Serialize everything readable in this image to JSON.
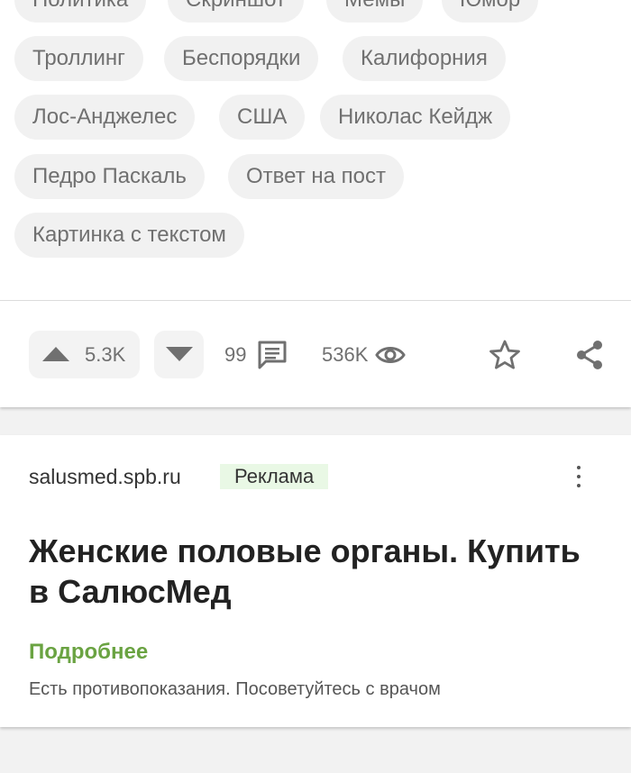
{
  "tags": [
    "Политика",
    "Скриншот",
    "Мемы",
    "Юмор",
    "Троллинг",
    "Беспорядки",
    "Калифорния",
    "Лос-Анджелес",
    "США",
    "Николас Кейдж",
    "Педро Паскаль",
    "Ответ на пост",
    "Картинка с текстом"
  ],
  "actions": {
    "rating": "5.3K",
    "comments": "99",
    "views": "536K"
  },
  "icons": {
    "upvote": "arrow-up-icon",
    "downvote": "arrow-down-icon",
    "comments": "comment-icon",
    "views": "eye-icon",
    "save": "star-icon",
    "share": "share-icon",
    "menu": "kebab-menu-icon"
  },
  "ad": {
    "domain": "salusmed.spb.ru",
    "badge": "Реклама",
    "title": "Женские половые органы. Купить в СалюсМед",
    "more": "Подробнее",
    "disclaimer": "Есть противопоказания. Посоветуйтесь с врачом"
  },
  "colors": {
    "accent_green": "#6aa342",
    "badge_bg": "#e9f8e5",
    "tag_bg": "#f1f1f1",
    "icon_gray": "#707070"
  }
}
